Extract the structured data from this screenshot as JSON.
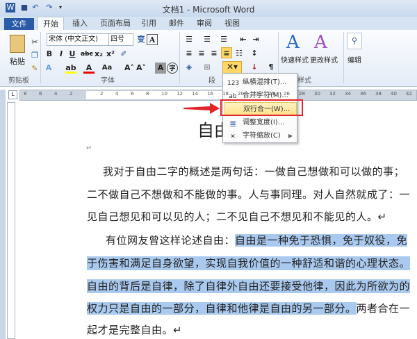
{
  "window": {
    "title": "文档1 - Microsoft Word"
  },
  "tabs": [
    "文件",
    "开始",
    "插入",
    "页面布局",
    "引用",
    "邮件",
    "审阅",
    "视图"
  ],
  "ribbon": {
    "clipboard": {
      "paste": "粘贴",
      "label": "剪贴板"
    },
    "font": {
      "font_name": "宋体 (中文正文)",
      "font_size": "四号",
      "label": "字体"
    },
    "paragraph": {
      "label": "段"
    },
    "styles": {
      "quick": "快速样式",
      "change": "更改样式",
      "label": "样式"
    },
    "editing": {
      "label": "编辑"
    }
  },
  "ruler": {
    "left_ticks": [
      "8",
      "6",
      "4",
      "2"
    ],
    "right_ticks": [
      "2",
      "4",
      "6",
      "8",
      "10",
      "12",
      "14",
      "16",
      "18",
      "20",
      "22",
      "24",
      "26",
      "28",
      "30",
      "32",
      "34",
      "36",
      "38",
      "40",
      "42"
    ]
  },
  "menu": {
    "items": [
      {
        "label": "纵横混排(T)...",
        "icon": "123"
      },
      {
        "label": "合并字符(M)...",
        "icon": "ab"
      },
      {
        "label": "双行合一(W)...",
        "icon": ""
      },
      {
        "label": "调整宽度(I)...",
        "icon": "≣"
      },
      {
        "label": "字符缩放(C)",
        "icon": "✕"
      }
    ]
  },
  "doc": {
    "title": "自由",
    "empty_mark": "↵",
    "lines": [
      "我对于自由二字的概述是两句话：一做自己想做和可以做的事；",
      "二不做自己不想做和不能做的事。人与事同理。对人自然就成了：一",
      "见自己想见和可以见的人；二不见自己不想见和不能见的人。↵"
    ],
    "p2_line1_plain": "有位网友曾这样论述自由：",
    "p2_line1_hl": "自由是一种免于恐惧，免于奴役，免",
    "p2_line2": "于伤害和满足自身欲望，实现自我价值的一种舒适和谐的心理状态。",
    "p2_line3": "自由的背后是自律，除了自律外自由还要接受他律，因此为所欲为的",
    "p2_line4_hl": "权力只是自由的一部分，自律和他律是自由的另一部分。",
    "p2_line4_plain": "两者合在一",
    "p2_line5": "起才是完整自由。↵"
  },
  "colors": {
    "accent": "#2a5aa8",
    "highlight": "#a9c9ee",
    "annotation": "#e0262a"
  }
}
